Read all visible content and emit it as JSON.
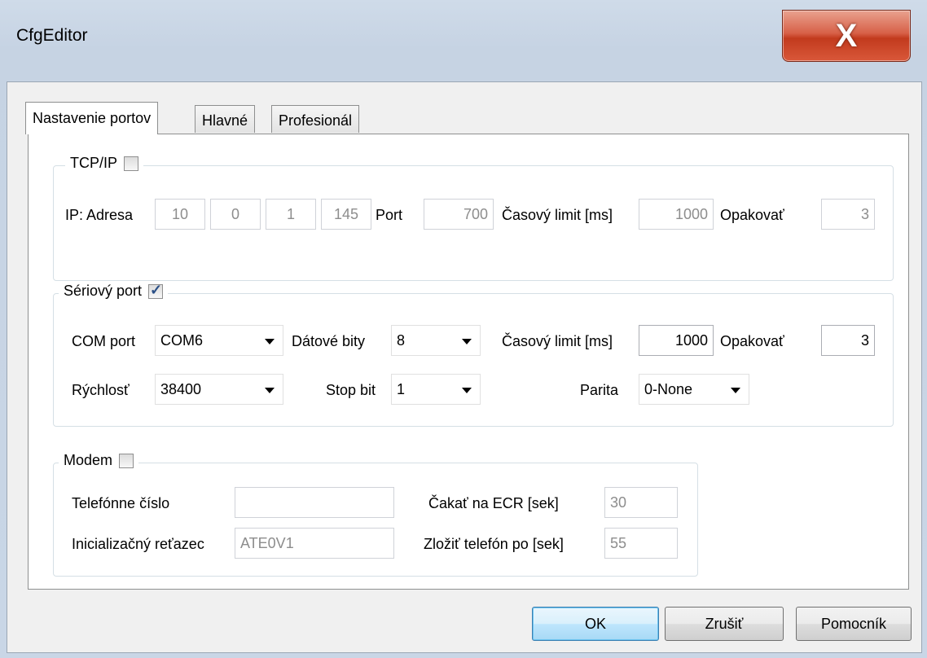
{
  "window": {
    "title": "CfgEditor",
    "close_glyph": "X"
  },
  "tabs": [
    {
      "label": "Nastavenie portov",
      "active": true
    },
    {
      "label": "Hlavné",
      "active": false
    },
    {
      "label": "Profesionál",
      "active": false
    }
  ],
  "tcpip": {
    "legend": "TCP/IP",
    "checked": false,
    "ip_label": "IP: Adresa",
    "ip": [
      "10",
      "0",
      "1",
      "145"
    ],
    "port_label": "Port",
    "port": "700",
    "timeout_label": "Časový limit [ms]",
    "timeout": "1000",
    "retry_label": "Opakovať",
    "retry": "3"
  },
  "serial": {
    "legend": "Sériový port",
    "checked": true,
    "com_label": "COM port",
    "com": "COM6",
    "databits_label": "Dátové bity",
    "databits": "8",
    "timeout_label": "Časový limit [ms]",
    "timeout": "1000",
    "retry_label": "Opakovať",
    "retry": "3",
    "speed_label": "Rýchlosť",
    "speed": "38400",
    "stopbit_label": "Stop bit",
    "stopbit": "1",
    "parity_label": "Parita",
    "parity": "0-None"
  },
  "modem": {
    "legend": "Modem",
    "checked": false,
    "phone_label": "Telefónne číslo",
    "phone": "",
    "init_label": "Inicializačný reťazec",
    "init": "ATE0V1",
    "wait_label": "Čakať na ECR [sek]",
    "wait": "30",
    "hangup_label": "Zložiť telefón po [sek]",
    "hangup": "55"
  },
  "buttons": {
    "ok": "OK",
    "cancel": "Zrušiť",
    "help": "Pomocník"
  }
}
